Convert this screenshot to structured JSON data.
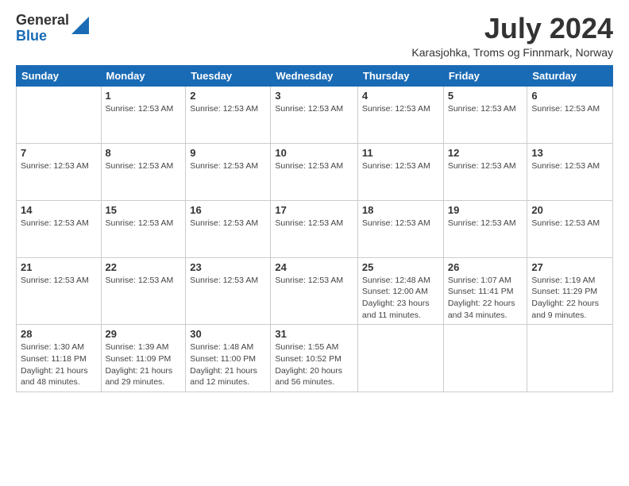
{
  "logo": {
    "general": "General",
    "blue": "Blue"
  },
  "title": {
    "month_year": "July 2024",
    "location": "Karasjohka, Troms og Finnmark, Norway"
  },
  "days_of_week": [
    "Sunday",
    "Monday",
    "Tuesday",
    "Wednesday",
    "Thursday",
    "Friday",
    "Saturday"
  ],
  "weeks": [
    [
      {
        "day": "",
        "info": ""
      },
      {
        "day": "1",
        "info": "Sunrise: 12:53 AM"
      },
      {
        "day": "2",
        "info": "Sunrise: 12:53 AM"
      },
      {
        "day": "3",
        "info": "Sunrise: 12:53 AM"
      },
      {
        "day": "4",
        "info": "Sunrise: 12:53 AM"
      },
      {
        "day": "5",
        "info": "Sunrise: 12:53 AM"
      },
      {
        "day": "6",
        "info": "Sunrise: 12:53 AM"
      }
    ],
    [
      {
        "day": "7",
        "info": "Sunrise: 12:53 AM"
      },
      {
        "day": "8",
        "info": "Sunrise: 12:53 AM"
      },
      {
        "day": "9",
        "info": "Sunrise: 12:53 AM"
      },
      {
        "day": "10",
        "info": "Sunrise: 12:53 AM"
      },
      {
        "day": "11",
        "info": "Sunrise: 12:53 AM"
      },
      {
        "day": "12",
        "info": "Sunrise: 12:53 AM"
      },
      {
        "day": "13",
        "info": "Sunrise: 12:53 AM"
      }
    ],
    [
      {
        "day": "14",
        "info": "Sunrise: 12:53 AM"
      },
      {
        "day": "15",
        "info": "Sunrise: 12:53 AM"
      },
      {
        "day": "16",
        "info": "Sunrise: 12:53 AM"
      },
      {
        "day": "17",
        "info": "Sunrise: 12:53 AM"
      },
      {
        "day": "18",
        "info": "Sunrise: 12:53 AM"
      },
      {
        "day": "19",
        "info": "Sunrise: 12:53 AM"
      },
      {
        "day": "20",
        "info": "Sunrise: 12:53 AM"
      }
    ],
    [
      {
        "day": "21",
        "info": "Sunrise: 12:53 AM"
      },
      {
        "day": "22",
        "info": "Sunrise: 12:53 AM"
      },
      {
        "day": "23",
        "info": "Sunrise: 12:53 AM"
      },
      {
        "day": "24",
        "info": "Sunrise: 12:53 AM"
      },
      {
        "day": "25",
        "info": "Sunrise: 12:48 AM\nSunset: 12:00 AM\nDaylight: 23 hours and 11 minutes."
      },
      {
        "day": "26",
        "info": "Sunrise: 1:07 AM\nSunset: 11:41 PM\nDaylight: 22 hours and 34 minutes."
      },
      {
        "day": "27",
        "info": "Sunrise: 1:19 AM\nSunset: 11:29 PM\nDaylight: 22 hours and 9 minutes."
      }
    ],
    [
      {
        "day": "28",
        "info": "Sunrise: 1:30 AM\nSunset: 11:18 PM\nDaylight: 21 hours and 48 minutes."
      },
      {
        "day": "29",
        "info": "Sunrise: 1:39 AM\nSunset: 11:09 PM\nDaylight: 21 hours and 29 minutes."
      },
      {
        "day": "30",
        "info": "Sunrise: 1:48 AM\nSunset: 11:00 PM\nDaylight: 21 hours and 12 minutes."
      },
      {
        "day": "31",
        "info": "Sunrise: 1:55 AM\nSunset: 10:52 PM\nDaylight: 20 hours and 56 minutes."
      },
      {
        "day": "",
        "info": ""
      },
      {
        "day": "",
        "info": ""
      },
      {
        "day": "",
        "info": ""
      }
    ]
  ]
}
